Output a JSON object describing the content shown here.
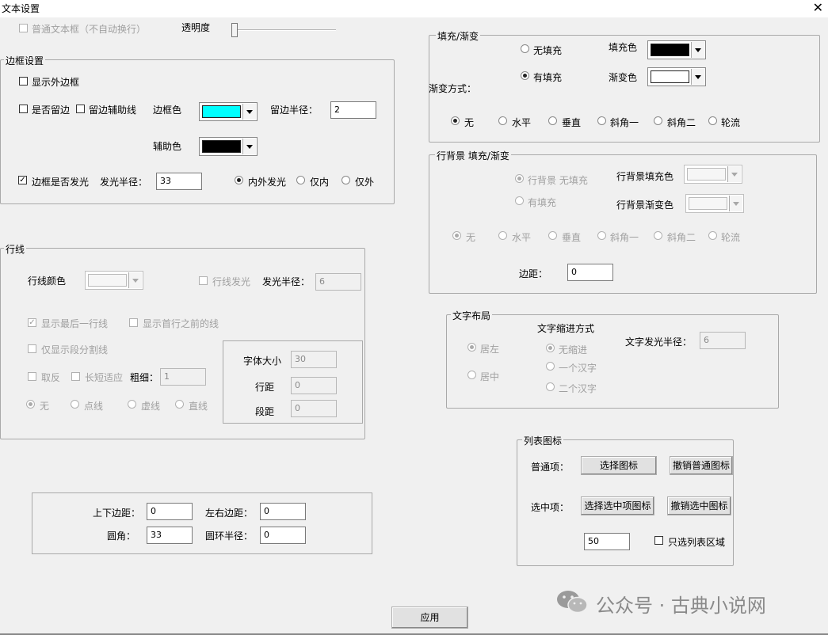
{
  "window": {
    "title": "文本设置",
    "close": "✕"
  },
  "top": {
    "plain_textbox": "普通文本框（不自动换行）",
    "opacity_label": "透明度"
  },
  "border": {
    "legend": "边框设置",
    "show_outer": "显示外边框",
    "keep_edge": "是否留边",
    "keep_aux": "留边辅助线",
    "border_color": "边框色",
    "keep_radius_label": "留边半径：",
    "keep_radius": "2",
    "aux_color": "辅助色",
    "glow": "边框是否发光",
    "glow_radius_label": "发光半径：",
    "glow_radius": "33",
    "opt_both": "内外发光",
    "opt_inner": "仅内",
    "opt_outer": "仅外",
    "colors": {
      "border": "#00ffff",
      "aux": "#000000"
    }
  },
  "row_line": {
    "legend": "行线",
    "color_label": "行线颜色",
    "glow": "行线发光",
    "glow_radius_label": "发光半径：",
    "glow_radius": "6",
    "show_last": "显示最后一行线",
    "show_before_first": "显示首行之前的线",
    "only_paragraph": "仅显示段分割线",
    "invert": "取反",
    "auto_len": "长短适应",
    "thickness_label": "粗细：",
    "thickness": "1",
    "style_none": "无",
    "style_dot": "点线",
    "style_dash": "虚线",
    "style_solid": "直线",
    "font_size_label": "字体大小",
    "font_size": "30",
    "line_spacing_label": "行距",
    "line_spacing": "0",
    "para_spacing_label": "段距",
    "para_spacing": "0"
  },
  "margins": {
    "tb_label": "上下边距：",
    "tb": "0",
    "lr_label": "左右边距：",
    "lr": "0",
    "corner_label": "圆角：",
    "corner": "33",
    "ring_label": "圆环半径：",
    "ring": "0"
  },
  "fill": {
    "legend": "填充/渐变",
    "no_fill": "无填充",
    "has_fill": "有填充",
    "fill_color": "填充色",
    "grad_color": "渐变色",
    "grad_mode": "渐变方式：",
    "g_none": "无",
    "g_h": "水平",
    "g_v": "垂直",
    "g_d1": "斜角一",
    "g_d2": "斜角二",
    "g_r": "轮流",
    "colors": {
      "fill": "#000000",
      "grad": "#ffffff"
    }
  },
  "row_bg": {
    "legend": "行背景 填充/渐变",
    "no_fill": "行背景 无填充",
    "has_fill": "有填充",
    "fill_color": "行背景填充色",
    "grad_color": "行背景渐变色",
    "g_none": "无",
    "g_h": "水平",
    "g_v": "垂直",
    "g_d1": "斜角一",
    "g_d2": "斜角二",
    "g_r": "轮流",
    "margin_label": "边距：",
    "margin": "0"
  },
  "layout": {
    "legend": "文字布局",
    "left": "居左",
    "center": "居中",
    "indent_title": "文字缩进方式",
    "no_indent": "无缩进",
    "one_char": "一个汉字",
    "two_char": "二个汉字",
    "glow_label": "文字发光半径：",
    "glow": "6"
  },
  "icons": {
    "legend": "列表图标",
    "normal_label": "普通项：",
    "choose_icon": "选择图标",
    "cancel_normal": "撤销普通图标",
    "selected_label": "选中项：",
    "choose_selected": "选择选中项图标",
    "cancel_selected": "撤销选中图标",
    "value": "50",
    "only_list": "只选列表区域"
  },
  "apply": "应用",
  "watermark": "公众号 · 古典小说网"
}
